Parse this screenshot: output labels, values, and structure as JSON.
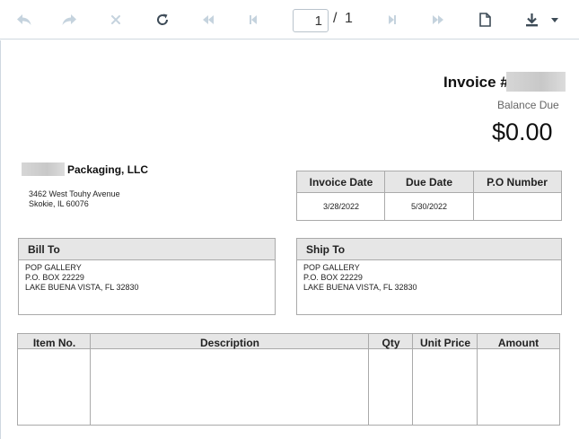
{
  "toolbar": {
    "page_current": "1",
    "page_separator": "/",
    "page_total": "1"
  },
  "invoice": {
    "title": "Invoice #",
    "balance_label": "Balance Due",
    "balance_value": "$0.00"
  },
  "company": {
    "name": "Packaging, LLC",
    "address_line1": "3462 West Touhy Avenue",
    "address_line2": "Skokie, IL 60076"
  },
  "info_table": {
    "headers": [
      "Invoice Date",
      "Due Date",
      "P.O Number"
    ],
    "values": [
      "3/28/2022",
      "5/30/2022",
      ""
    ]
  },
  "bill_to": {
    "label": "Bill To",
    "lines": [
      "POP GALLERY",
      "P.O. BOX 22229",
      "LAKE BUENA VISTA, FL 32830"
    ]
  },
  "ship_to": {
    "label": "Ship To",
    "lines": [
      "POP GALLERY",
      "P.O. BOX 22229",
      "LAKE BUENA VISTA, FL 32830"
    ]
  },
  "items_table": {
    "headers": [
      "Item No.",
      "Description",
      "Qty",
      "Unit Price",
      "Amount"
    ]
  },
  "icons": {
    "back": "back-arrow-icon",
    "forward": "forward-arrow-icon",
    "close": "close-icon",
    "refresh": "refresh-icon",
    "first": "first-page-icon",
    "prev": "previous-page-icon",
    "next": "next-page-icon",
    "last": "last-page-icon",
    "document": "document-icon",
    "download": "download-icon",
    "dropdown": "dropdown-caret-icon"
  },
  "colors": {
    "toolbar_icon_disabled": "#c5d3de",
    "toolbar_icon_active": "#3d4b57",
    "table_header_bg": "#e6e6e6",
    "border": "#aaaaaa"
  }
}
